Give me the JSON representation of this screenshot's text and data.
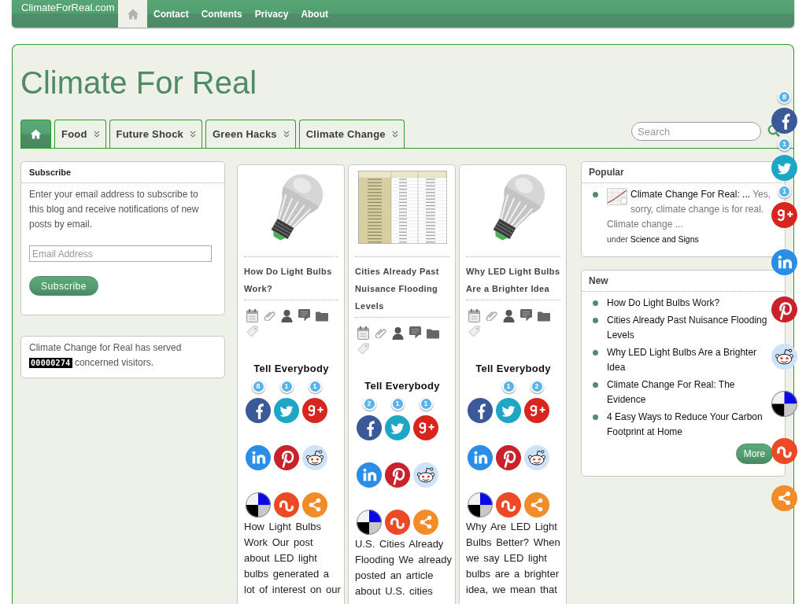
{
  "top_bar": {
    "site_name": "ClimateForReal.com",
    "items": [
      {
        "kind": "home",
        "selected": true
      },
      {
        "kind": "link",
        "label": "Contact",
        "selected": false
      },
      {
        "kind": "link",
        "label": "Contents",
        "selected": false
      },
      {
        "kind": "link",
        "label": "Privacy",
        "selected": false
      },
      {
        "kind": "link",
        "label": "About",
        "selected": false
      }
    ]
  },
  "header": {
    "title": "Climate For Real"
  },
  "main_nav": {
    "tabs": [
      {
        "kind": "home",
        "selected": true
      },
      {
        "kind": "link",
        "label": "Food",
        "selected": false,
        "dropdown": true
      },
      {
        "kind": "link",
        "label": "Future Shock",
        "selected": false,
        "dropdown": true
      },
      {
        "kind": "link",
        "label": "Green Hacks",
        "selected": false,
        "dropdown": true
      },
      {
        "kind": "link",
        "label": "Climate Change",
        "selected": false,
        "dropdown": true
      }
    ],
    "search": {
      "placeholder": "Search"
    }
  },
  "left_sidebar": {
    "subscribe": {
      "title": "Subscribe",
      "text": "Enter your email address to subscribe to this blog and receive notifications of new posts by email.",
      "email": {
        "placeholder": "Email Address"
      },
      "button": "Subscribe"
    },
    "visitor_counter": {
      "text_before": "Climate Change for Real has served",
      "count": "00000274",
      "text_after": "concerned visitors."
    }
  },
  "posts": [
    {
      "image": {
        "kind": "light_bulb"
      },
      "title": "How Do Light Bulbs Work?",
      "share_heading": "Tell Everybody",
      "shares": [
        {
          "kind": "facebook",
          "count": "8"
        },
        {
          "kind": "twitter",
          "count": "1"
        },
        {
          "kind": "googleplus",
          "count": "1"
        },
        {
          "kind": "linkedin"
        },
        {
          "kind": "pinterest"
        },
        {
          "kind": "reddit"
        },
        {
          "kind": "delicious"
        },
        {
          "kind": "stumbleupon"
        },
        {
          "kind": "share"
        }
      ],
      "excerpt": "How Light Bulbs Work Our post about LED light bulbs generated a lot of interest on our"
    },
    {
      "image": {
        "kind": "table"
      },
      "title": "Cities Already Past Nuisance Flooding Levels",
      "share_heading": "Tell Everybody",
      "shares": [
        {
          "kind": "facebook",
          "count": "2"
        },
        {
          "kind": "twitter",
          "count": "1"
        },
        {
          "kind": "googleplus",
          "count": "1"
        },
        {
          "kind": "linkedin"
        },
        {
          "kind": "pinterest"
        },
        {
          "kind": "reddit"
        },
        {
          "kind": "delicious"
        },
        {
          "kind": "stumbleupon"
        },
        {
          "kind": "share"
        }
      ],
      "excerpt": "U.S. Cities Already Flooding We already posted an article about U.S. cities"
    },
    {
      "image": {
        "kind": "light_bulb"
      },
      "title": "Why LED Light Bulbs Are a Brighter Idea",
      "share_heading": "Tell Everybody",
      "shares": [
        {
          "kind": "facebook"
        },
        {
          "kind": "twitter",
          "count": "1"
        },
        {
          "kind": "googleplus",
          "count": "2"
        },
        {
          "kind": "linkedin"
        },
        {
          "kind": "pinterest"
        },
        {
          "kind": "reddit"
        },
        {
          "kind": "delicious"
        },
        {
          "kind": "stumbleupon"
        },
        {
          "kind": "share"
        }
      ],
      "excerpt": "Why Are LED Light Bulbs Better? When we say LED light bulbs are a brighter idea, we mean that"
    }
  ],
  "right_sidebar": {
    "popular": {
      "title": "Popular",
      "items": [
        {
          "title": "Climate Change For Real: ...",
          "excerpt": "Yes, sorry, climate change is for real. Climate change ...",
          "category_prefix": "under",
          "category": "Science and Signs"
        }
      ]
    },
    "new": {
      "title": "New",
      "items": [
        "How Do Light Bulbs Work?",
        "Cities Already Past Nuisance Flooding Levels",
        "Why LED Light Bulbs Are a Brighter Idea",
        "Climate Change For Real: The Evidence",
        "4 Easy Ways to Reduce Your Carbon Footprint at Home"
      ],
      "more_button": "More"
    }
  },
  "floating_share_bar": {
    "shares": [
      {
        "kind": "facebook",
        "count": "8"
      },
      {
        "kind": "twitter",
        "count": "1"
      },
      {
        "kind": "googleplus",
        "count": "1"
      },
      {
        "kind": "linkedin"
      },
      {
        "kind": "pinterest"
      },
      {
        "kind": "reddit"
      },
      {
        "kind": "delicious"
      },
      {
        "kind": "stumbleupon"
      },
      {
        "kind": "share"
      }
    ]
  }
}
